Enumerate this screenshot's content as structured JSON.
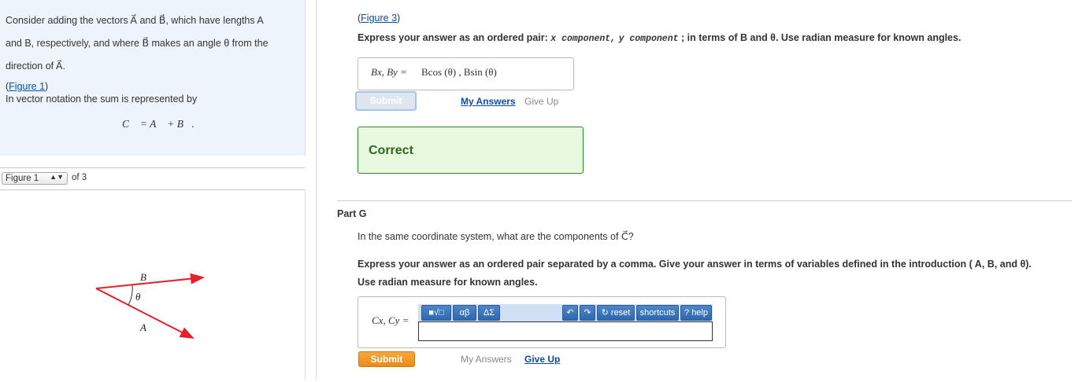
{
  "intro": {
    "line1": "Consider adding the vectors A⃗ and B⃗, which have lengths A",
    "line2": "and B, respectively, and where B⃗ makes an angle θ from the",
    "line3": "direction of A⃗.",
    "figure_link": "Figure 1",
    "line4": "In vector notation the sum is represented by",
    "equation": "C⃗ = A⃗ + B⃗."
  },
  "figure_nav": {
    "selected": "Figure 1",
    "of_label": "of 3"
  },
  "figure": {
    "label_b": "B⃗",
    "label_a": "A⃗",
    "label_theta": "θ",
    "arrow_color": "#e8202a"
  },
  "part_f": {
    "figure_link": "Figure 3",
    "instruction_prefix": "Express your answer as an ordered pair:",
    "x_comp": "x component,",
    "y_comp": "y component",
    "instruction_suffix": "; in terms of B and θ. Use radian measure for known angles.",
    "answer_label": "Bx, By =",
    "answer_value": "Bcos (θ) , Bsin (θ)",
    "submit": "Submit",
    "my_answers": "My Answers",
    "give_up": "Give Up",
    "feedback": "Correct"
  },
  "part_g": {
    "title": "Part G",
    "question": "In the same coordinate system, what are the components of C⃗?",
    "instruction1": "Express your answer as an ordered pair separated by a comma. Give your answer in terms of variables defined in the introduction ( A, B, and θ).",
    "instruction2": "Use radian measure for known angles.",
    "answer_label": "Cx, Cy =",
    "answer_value": "",
    "toolbar": {
      "templates": "■√□",
      "greek": "αβ",
      "symbols": "ΔΣ",
      "undo": "↶",
      "redo": "↷",
      "reset": "reset",
      "shortcuts": "shortcuts",
      "help": "help"
    },
    "submit": "Submit",
    "my_answers": "My Answers",
    "give_up": "Give Up"
  }
}
